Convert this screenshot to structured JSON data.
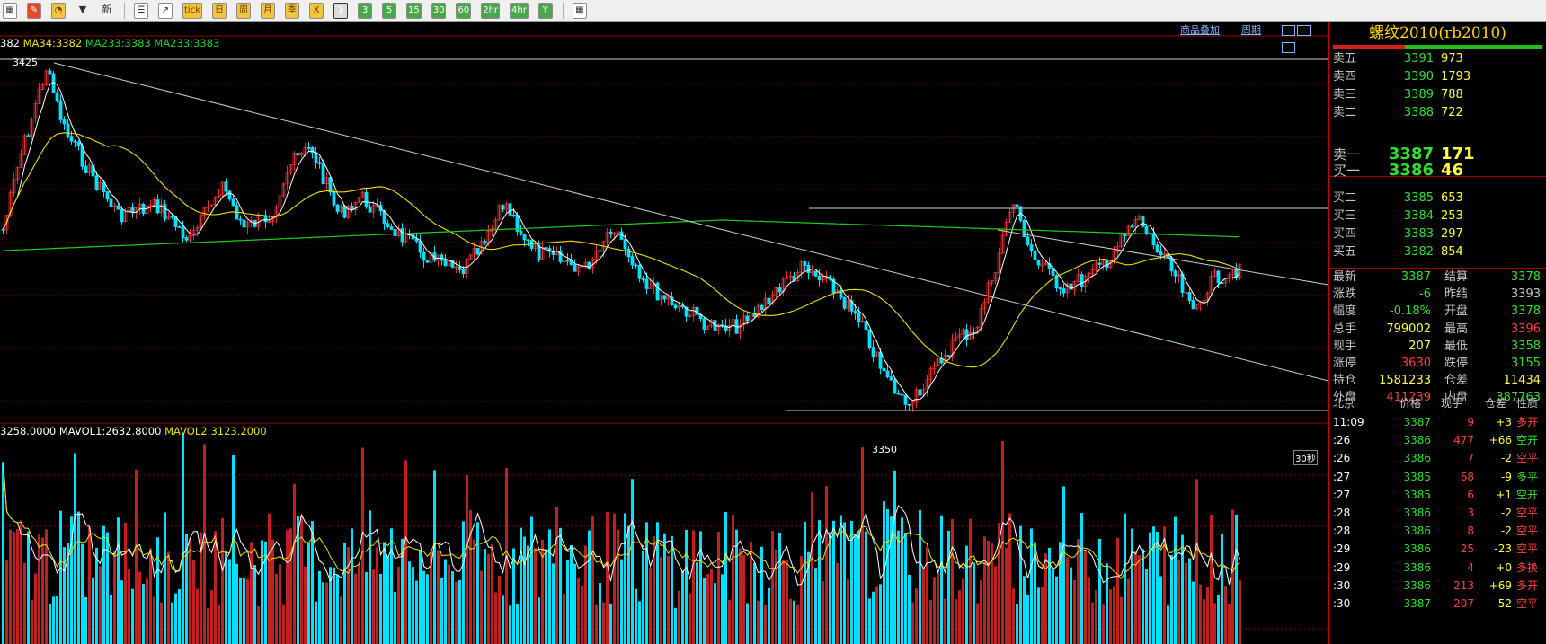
{
  "toolbar": {
    "buttons": [
      {
        "label": "▦",
        "style": "w",
        "name": "layout-icon"
      },
      {
        "label": "✎",
        "style": "r",
        "name": "pen-icon"
      },
      {
        "label": "◔",
        "style": "y",
        "name": "paint-icon"
      },
      {
        "label": "▼",
        "style": "plain",
        "name": "filter-icon"
      },
      {
        "label": "新",
        "style": "plain",
        "name": "new-button"
      },
      {
        "sep": true
      },
      {
        "label": "☰",
        "style": "w",
        "name": "list-icon"
      },
      {
        "label": "↗",
        "style": "w",
        "name": "trend-icon"
      },
      {
        "label": "tick",
        "style": "y",
        "name": "tick-button"
      },
      {
        "label": "日",
        "style": "y",
        "name": "period-day"
      },
      {
        "label": "周",
        "style": "y",
        "name": "period-week"
      },
      {
        "label": "月",
        "style": "y",
        "name": "period-month"
      },
      {
        "label": "季",
        "style": "y",
        "name": "period-quarter"
      },
      {
        "label": "X",
        "style": "y",
        "name": "period-x"
      },
      {
        "label": "1",
        "style": "g sel",
        "name": "period-1min"
      },
      {
        "label": "3",
        "style": "g",
        "name": "period-3min"
      },
      {
        "label": "5",
        "style": "g",
        "name": "period-5min"
      },
      {
        "label": "15",
        "style": "g",
        "name": "period-15min"
      },
      {
        "label": "30",
        "style": "g",
        "name": "period-30min"
      },
      {
        "label": "60",
        "style": "g",
        "name": "period-60min"
      },
      {
        "label": "2hr",
        "style": "g",
        "name": "period-2hr"
      },
      {
        "label": "4hr",
        "style": "g",
        "name": "period-4hr"
      },
      {
        "label": "Y",
        "style": "g",
        "name": "period-year"
      },
      {
        "sep": true
      },
      {
        "label": "▦",
        "style": "w",
        "name": "calculator-icon"
      }
    ]
  },
  "indicators": {
    "ma_line": {
      "ma_a": "382",
      "ma34": "MA34:3382",
      "ma233a": "MA233:3383",
      "ma233b": "MA233:3383"
    },
    "vol_line": {
      "vol": "3258.0000",
      "mavol1": "MAVOL1:2632.8000",
      "mavol2": "MAVOL2:3123.2000"
    },
    "high_label": "3425",
    "low_label": "3350",
    "timer": "30秒",
    "overlay_link": "商品叠加",
    "period_link": "周期"
  },
  "colors": {
    "up": "#e03030",
    "down": "#00e0ff",
    "ma_white": "#ffffff",
    "ma_yellow": "#f0e000",
    "ma_green": "#20d020",
    "grid": "#8a0000",
    "red": "#ff4040",
    "green": "#30e030",
    "yellow": "#ffff40",
    "gray": "#c8c8c8"
  },
  "quote": {
    "title": "螺纹2010(rb2010)",
    "asks": [
      {
        "label": "卖五",
        "price": "3391",
        "vol": "973"
      },
      {
        "label": "卖四",
        "price": "3390",
        "vol": "1793"
      },
      {
        "label": "卖三",
        "price": "3389",
        "vol": "788"
      },
      {
        "label": "卖二",
        "price": "3388",
        "vol": "722"
      },
      {
        "label": "卖一",
        "price": "3387",
        "vol": "171"
      }
    ],
    "bids": [
      {
        "label": "买一",
        "price": "3386",
        "vol": "46"
      },
      {
        "label": "买二",
        "price": "3385",
        "vol": "653"
      },
      {
        "label": "买三",
        "price": "3384",
        "vol": "253"
      },
      {
        "label": "买四",
        "price": "3383",
        "vol": "297"
      },
      {
        "label": "买五",
        "price": "3382",
        "vol": "854"
      }
    ],
    "stats": [
      {
        "l1": "最新",
        "v1": "3387",
        "c1": "g",
        "l2": "结算",
        "v2": "3378",
        "c2": "g"
      },
      {
        "l1": "涨跌",
        "v1": "-6",
        "c1": "g",
        "l2": "昨结",
        "v2": "3393",
        "c2": "w"
      },
      {
        "l1": "幅度",
        "v1": "-0.18%",
        "c1": "g",
        "l2": "开盘",
        "v2": "3378",
        "c2": "g"
      },
      {
        "l1": "总手",
        "v1": "799002",
        "c1": "y",
        "l2": "最高",
        "v2": "3396",
        "c2": "r"
      },
      {
        "l1": "现手",
        "v1": "207",
        "c1": "y",
        "l2": "最低",
        "v2": "3358",
        "c2": "g"
      },
      {
        "l1": "涨停",
        "v1": "3630",
        "c1": "r",
        "l2": "跌停",
        "v2": "3155",
        "c2": "g"
      },
      {
        "l1": "持仓",
        "v1": "1581233",
        "c1": "y",
        "l2": "仓差",
        "v2": "11434",
        "c2": "y"
      },
      {
        "l1": "外盘",
        "v1": "411239",
        "c1": "r",
        "l2": "内盘",
        "v2": "387763",
        "c2": "g"
      }
    ],
    "tick_header": {
      "city": "北京",
      "price": "价格",
      "vol": "现手",
      "oi": "仓差",
      "type": "性质"
    },
    "ticks": [
      {
        "time": "11:09",
        "price": "3387",
        "vol": "9",
        "oi": "+3",
        "type": "多开",
        "tc": "r"
      },
      {
        "time": ":26",
        "price": "3386",
        "vol": "477",
        "oi": "+66",
        "type": "空开",
        "tc": "g"
      },
      {
        "time": ":26",
        "price": "3386",
        "vol": "7",
        "oi": "-2",
        "type": "空平",
        "tc": "r"
      },
      {
        "time": ":27",
        "price": "3385",
        "vol": "68",
        "oi": "-9",
        "type": "多平",
        "tc": "g"
      },
      {
        "time": ":27",
        "price": "3385",
        "vol": "6",
        "oi": "+1",
        "type": "空开",
        "tc": "g"
      },
      {
        "time": ":28",
        "price": "3386",
        "vol": "3",
        "oi": "-2",
        "type": "空平",
        "tc": "r"
      },
      {
        "time": ":28",
        "price": "3386",
        "vol": "8",
        "oi": "-2",
        "type": "空平",
        "tc": "r"
      },
      {
        "time": ":29",
        "price": "3386",
        "vol": "25",
        "oi": "-23",
        "type": "空平",
        "tc": "r"
      },
      {
        "time": ":29",
        "price": "3386",
        "vol": "4",
        "oi": "+0",
        "type": "多换",
        "tc": "r"
      },
      {
        "time": ":30",
        "price": "3386",
        "vol": "213",
        "oi": "+69",
        "type": "多开",
        "tc": "r"
      },
      {
        "time": ":30",
        "price": "3387",
        "vol": "207",
        "oi": "-52",
        "type": "空平",
        "tc": "r"
      }
    ]
  }
}
